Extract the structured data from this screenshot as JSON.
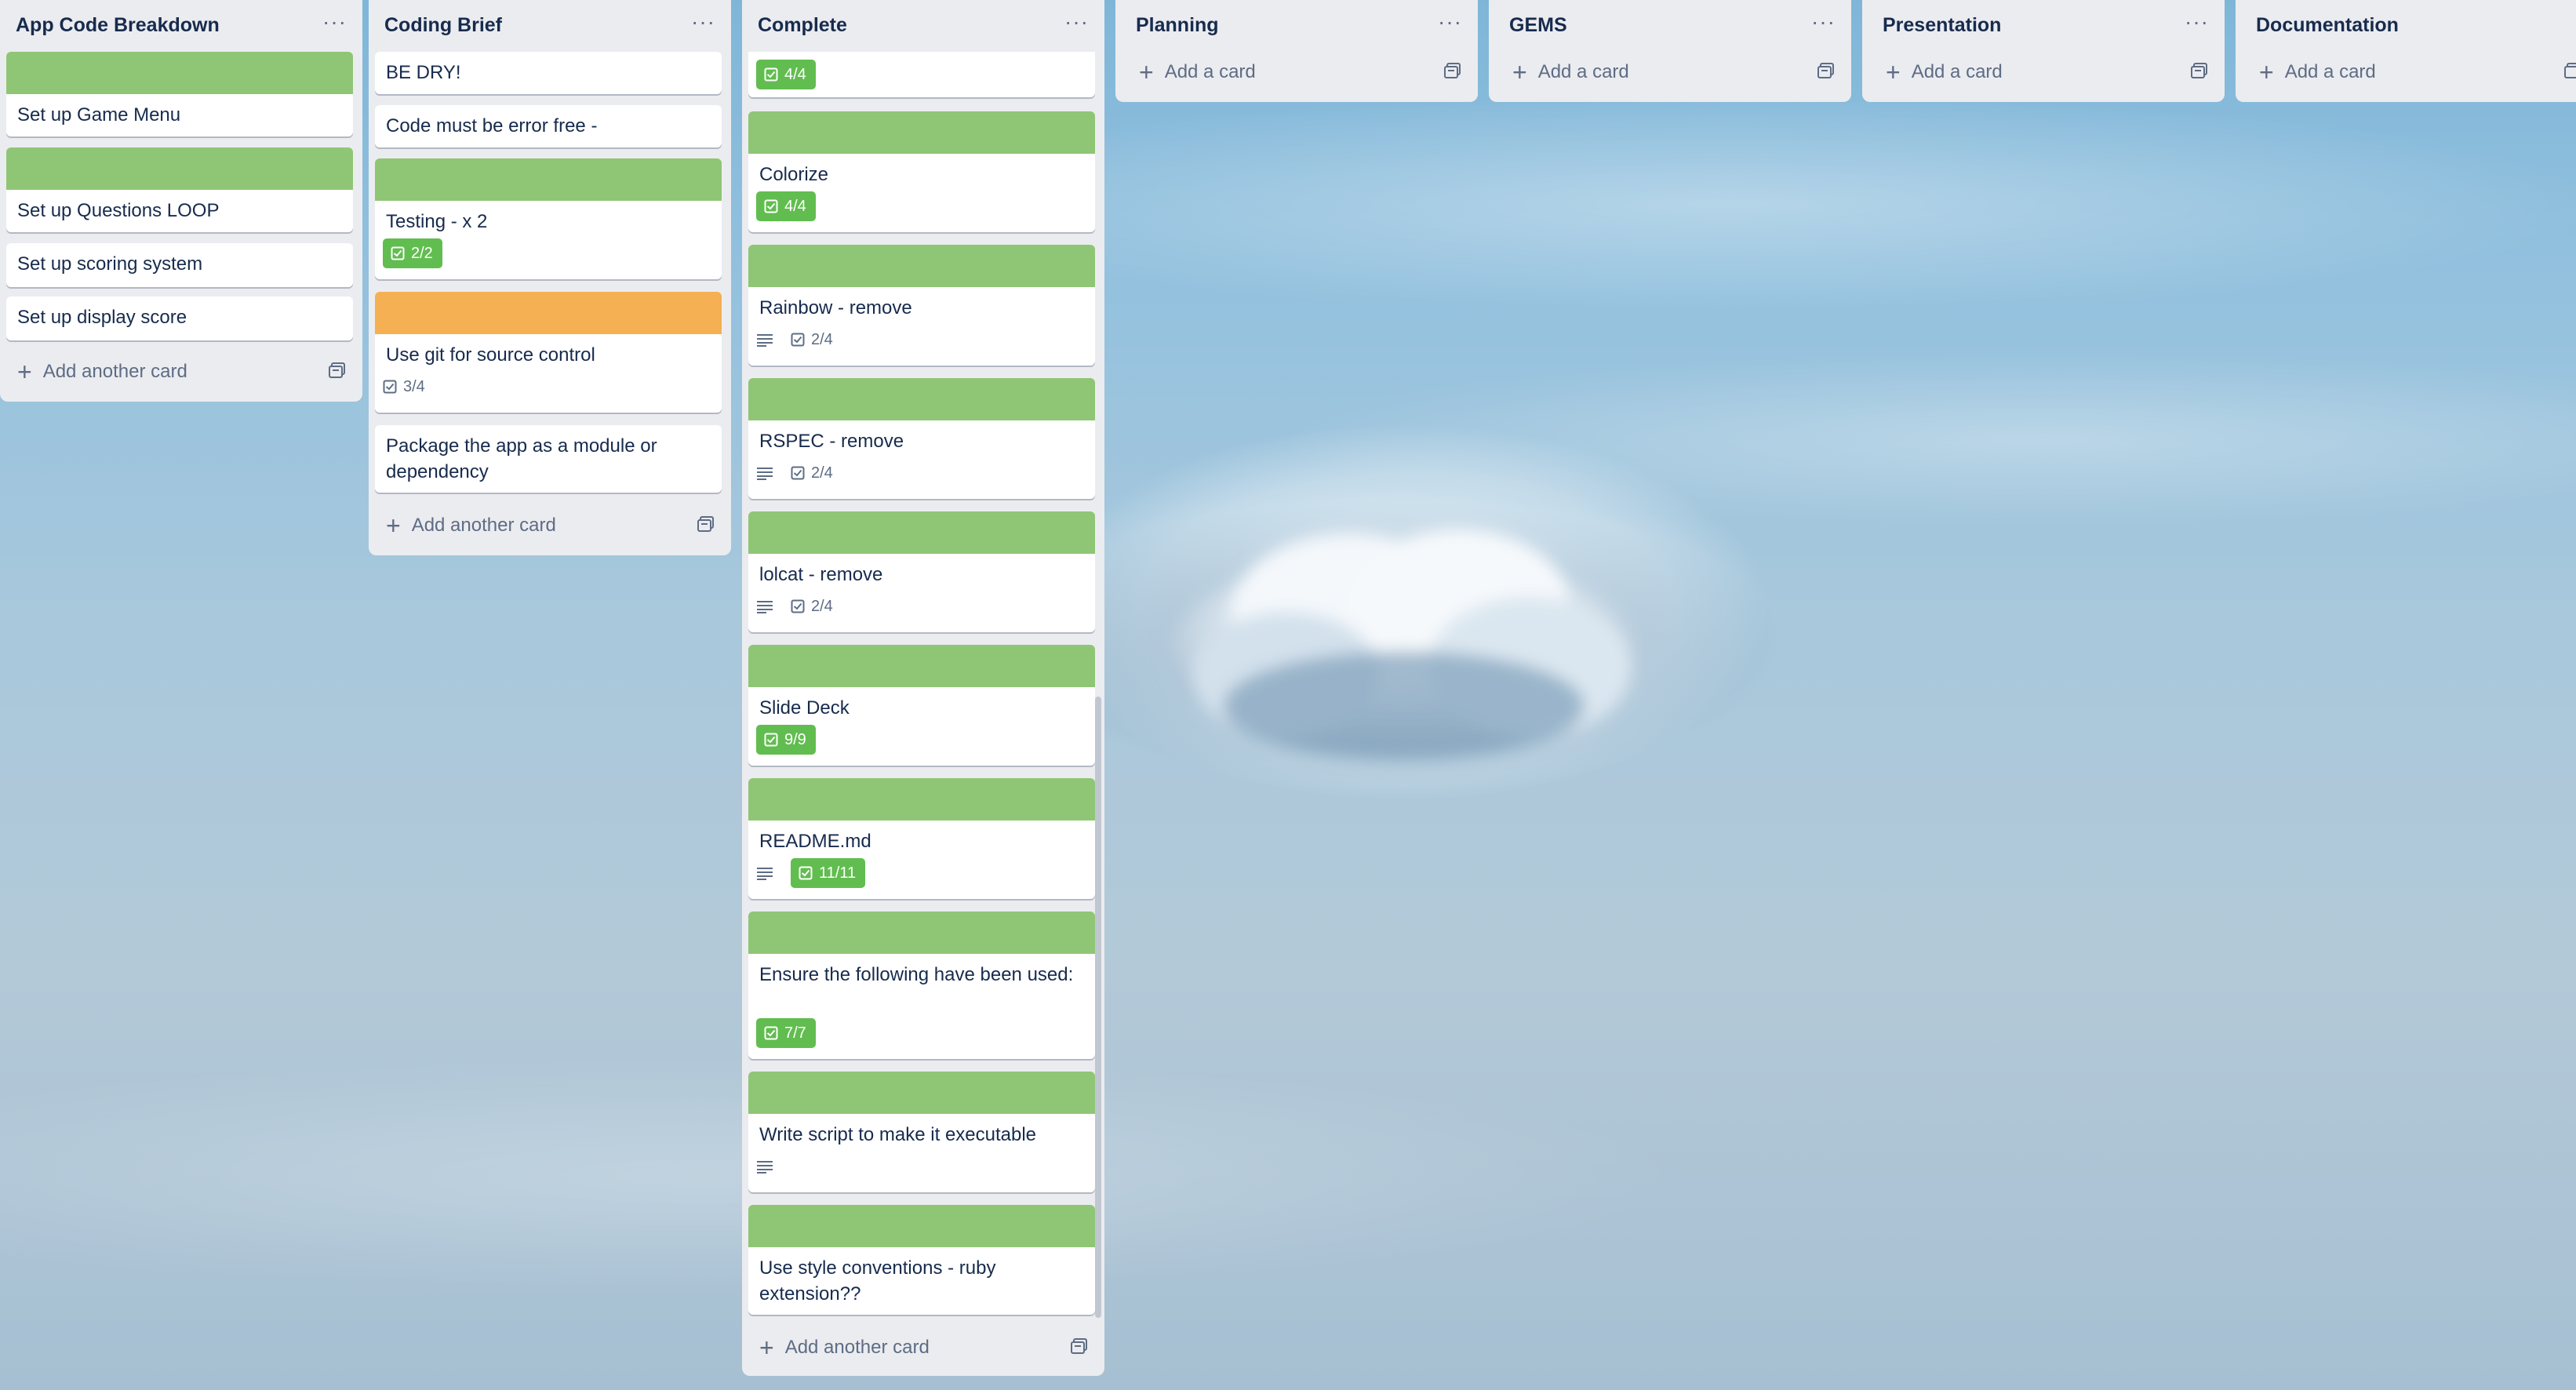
{
  "lists": [
    {
      "title": "App Code Breakdown",
      "cards": [
        {
          "title": "Set up Game Menu",
          "cover": "green"
        },
        {
          "title": "Set up Questions LOOP",
          "cover": "green"
        },
        {
          "title": "Set up scoring system"
        },
        {
          "title": "Set up display score"
        }
      ],
      "add_label": "Add another card"
    },
    {
      "title": "Coding Brief",
      "cards": [
        {
          "title": "BE DRY!"
        },
        {
          "title": "Code must be error free -"
        },
        {
          "title": "Testing - x 2",
          "cover": "green",
          "checklist": "2/2",
          "checklist_complete": true
        },
        {
          "title": "Use git for source control",
          "cover": "orange",
          "checklist": "3/4"
        },
        {
          "title": "Package the app as a module or dependency"
        }
      ],
      "add_label": "Add another card"
    },
    {
      "title": "Complete",
      "cards": [
        {
          "title": "",
          "checklist": "4/4",
          "checklist_complete": true
        },
        {
          "title": "Colorize",
          "cover": "green",
          "checklist": "4/4",
          "checklist_complete": true
        },
        {
          "title": "Rainbow - remove",
          "cover": "green",
          "has_description": true,
          "checklist": "2/4"
        },
        {
          "title": "RSPEC - remove",
          "cover": "green",
          "has_description": true,
          "checklist": "2/4"
        },
        {
          "title": "lolcat - remove",
          "cover": "green",
          "has_description": true,
          "checklist": "2/4"
        },
        {
          "title": "Slide Deck",
          "cover": "green",
          "checklist": "9/9",
          "checklist_complete": true
        },
        {
          "title": "README.md",
          "cover": "green",
          "has_description": true,
          "checklist": "11/11",
          "checklist_complete": true
        },
        {
          "title": "Ensure the following have been used:",
          "cover": "green",
          "checklist": "7/7",
          "checklist_complete": true
        },
        {
          "title": "Write script to make it executable",
          "cover": "green",
          "has_description": true
        },
        {
          "title": "Use style conventions - ruby extension??",
          "cover": "green"
        }
      ],
      "add_label": "Add another card"
    },
    {
      "title": "Planning",
      "cards": [],
      "add_label": "Add a card"
    },
    {
      "title": "GEMS",
      "cards": [],
      "add_label": "Add a card"
    },
    {
      "title": "Presentation",
      "cards": [],
      "add_label": "Add a card"
    },
    {
      "title": "Documentation",
      "cards": [],
      "add_label": "Add a card"
    }
  ],
  "icons": {
    "menu": "more-horizontal-icon",
    "add": "plus-icon",
    "template": "card-template-icon",
    "description": "description-lines-icon",
    "checklist": "checkbox-icon"
  },
  "colors": {
    "cover_green": "#8fc675",
    "cover_orange": "#f4b053",
    "badge_complete": "#61bd4f",
    "list_bg": "#ebecf0"
  }
}
